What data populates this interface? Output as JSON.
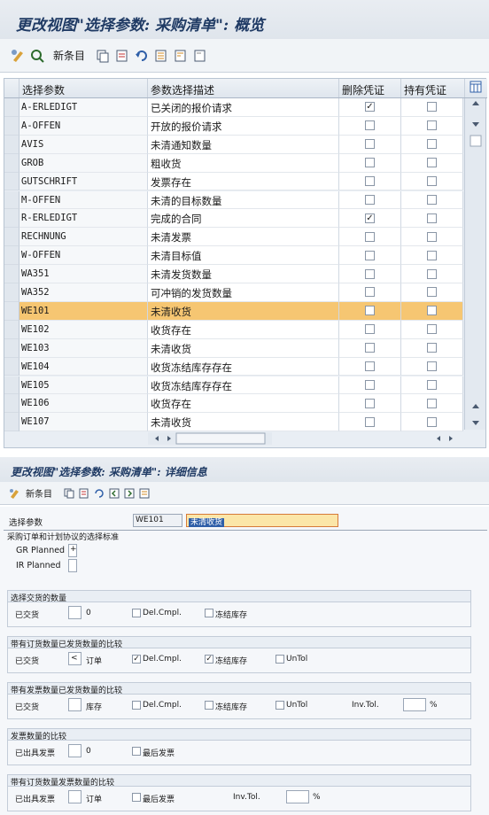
{
  "overview": {
    "title": "更改视图\"选择参数: 采购清单\": 概览",
    "toolbar": {
      "new_entries": "新条目"
    },
    "columns": [
      "选择参数",
      "参数选择描述",
      "删除凭证",
      "持有凭证"
    ],
    "rows": [
      {
        "param": "A-ERLEDIGT",
        "desc": "已关闭的报价请求",
        "delete": true,
        "hold": false
      },
      {
        "param": "A-OFFEN",
        "desc": "开放的报价请求",
        "delete": false,
        "hold": false
      },
      {
        "param": "AVIS",
        "desc": "未清通知数量",
        "delete": false,
        "hold": false
      },
      {
        "param": "GROB",
        "desc": "粗收货",
        "delete": false,
        "hold": false
      },
      {
        "param": "GUTSCHRIFT",
        "desc": "发票存在",
        "delete": false,
        "hold": false
      },
      {
        "param": "M-OFFEN",
        "desc": "未清的目标数量",
        "delete": false,
        "hold": false
      },
      {
        "param": "R-ERLEDIGT",
        "desc": "完成的合同",
        "delete": true,
        "hold": false
      },
      {
        "param": "RECHNUNG",
        "desc": "未清发票",
        "delete": false,
        "hold": false
      },
      {
        "param": "W-OFFEN",
        "desc": "未清目标值",
        "delete": false,
        "hold": false
      },
      {
        "param": "WA351",
        "desc": "未清发货数量",
        "delete": false,
        "hold": false
      },
      {
        "param": "WA352",
        "desc": "可冲销的发货数量",
        "delete": false,
        "hold": false
      },
      {
        "param": "WE101",
        "desc": "未清收货",
        "delete": false,
        "hold": false,
        "selected": true
      },
      {
        "param": "WE102",
        "desc": "收货存在",
        "delete": false,
        "hold": false
      },
      {
        "param": "WE103",
        "desc": "未清收货",
        "delete": false,
        "hold": false
      },
      {
        "param": "WE104",
        "desc": "收货冻结库存存在",
        "delete": false,
        "hold": false
      },
      {
        "param": "WE105",
        "desc": "收货冻结库存存在",
        "delete": false,
        "hold": false
      },
      {
        "param": "WE106",
        "desc": "收货存在",
        "delete": false,
        "hold": false
      },
      {
        "param": "WE107",
        "desc": "未清收货",
        "delete": false,
        "hold": false
      }
    ]
  },
  "detail": {
    "title": "更改视图\"选择参数: 采购清单\": 详细信息",
    "toolbar": {
      "new_entries": "新条目"
    },
    "param_label": "选择参数",
    "param_value": "WE101",
    "param_desc": "未清收货",
    "criteria_header": "采购订单和计划协议的选择标准",
    "gr_planned": {
      "label": "GR Planned",
      "value": "+"
    },
    "ir_planned": {
      "label": "IR Planned",
      "value": ""
    },
    "g1": {
      "title": "选择交货的数量",
      "label": "已交货",
      "value": "0",
      "opt1": "Del.Cmpl.",
      "opt2": "冻结库存"
    },
    "g2": {
      "title": "带有订货数量已发货数量的比较",
      "label": "已交货",
      "value": "<",
      "unit": "订单",
      "opt1": "Del.Cmpl.",
      "opt1_checked": true,
      "opt2": "冻结库存",
      "opt2_checked": true,
      "opt3": "UnTol"
    },
    "g3": {
      "title": "带有发票数量已发货数量的比较",
      "label": "已交货",
      "unit": "库存",
      "opt1": "Del.Cmpl.",
      "opt2": "冻结库存",
      "opt3": "UnTol",
      "tol_label": "Inv.Tol.",
      "pct": "%"
    },
    "g4": {
      "title": "发票数量的比较",
      "label": "已出具发票",
      "value": "0",
      "opt1": "最后发票"
    },
    "g5": {
      "title": "带有订货数量发票数量的比较",
      "label": "已出具发票",
      "unit": "订单",
      "opt1": "最后发票",
      "tol_label": "Inv.Tol.",
      "pct": "%"
    }
  },
  "colors": {
    "accent": "#f6c672",
    "title": "#1f3a64"
  }
}
